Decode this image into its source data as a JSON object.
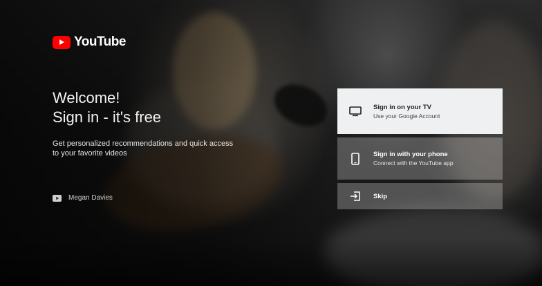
{
  "brand": {
    "logo_text": "YouTube",
    "logo_color": "#ff0000"
  },
  "welcome": {
    "line1": "Welcome!",
    "line2": "Sign in - it's free",
    "description": "Get personalized recommendations and quick access to your favorite videos"
  },
  "account": {
    "name": "Megan Davies",
    "icon": "youtube-play-icon"
  },
  "options": [
    {
      "title": "Sign in on your TV",
      "subtitle": "Use your Google Account",
      "icon": "tv-icon"
    },
    {
      "title": "Sign in with your phone",
      "subtitle": "Connect with the YouTube app",
      "icon": "phone-icon"
    },
    {
      "title": "Skip",
      "subtitle": "",
      "icon": "skip-icon"
    }
  ]
}
